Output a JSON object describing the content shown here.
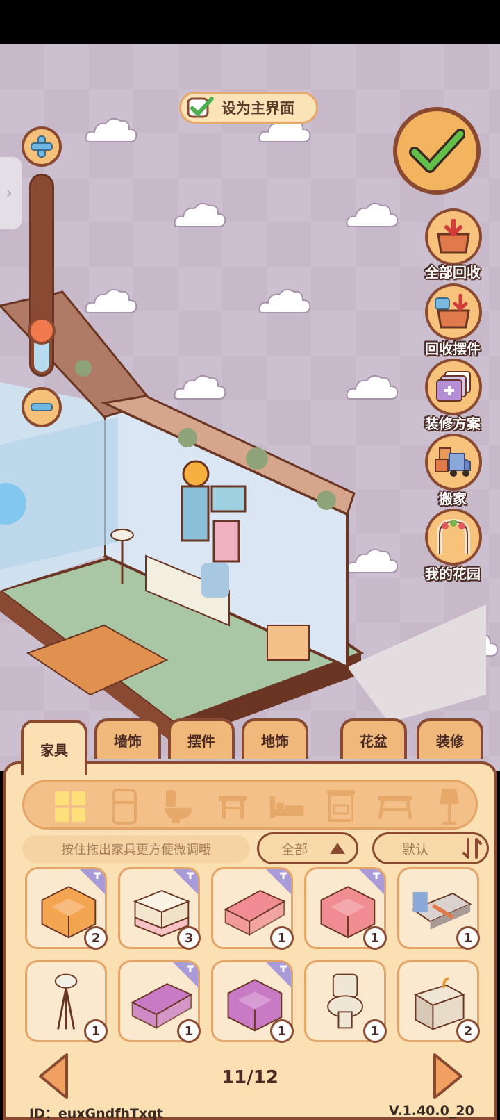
{
  "top_button": {
    "label": "设为主界面"
  },
  "side_buttons": [
    {
      "label": "全部回收",
      "icon": "recycle-box-icon"
    },
    {
      "label": "回收摆件",
      "icon": "recycle-ornament-icon"
    },
    {
      "label": "装修方案",
      "icon": "decoration-plan-icon"
    },
    {
      "label": "搬家",
      "icon": "moving-truck-icon"
    },
    {
      "label": "我的花园",
      "icon": "garden-arch-icon"
    }
  ],
  "zoom": {
    "level_fraction": 0.28
  },
  "tabs": [
    "家具",
    "墙饰",
    "摆件",
    "地饰",
    "花盆",
    "装修"
  ],
  "active_tab": "家具",
  "categories": [
    "grid-icon",
    "fridge-icon",
    "toilet-icon",
    "table-icon",
    "bed-icon",
    "cabinet-icon",
    "desk-icon",
    "lamp-icon"
  ],
  "hint": "按住拖出家具更方便微调哦",
  "filter": {
    "label": "全部"
  },
  "sort": {
    "label": "默认"
  },
  "items": [
    {
      "name": "orange-corner-sofa",
      "count": "2",
      "color": "#f3a552",
      "new": true
    },
    {
      "name": "cream-pink-ottoman",
      "count": "3",
      "color": "#f6c2c4",
      "new": true
    },
    {
      "name": "pink-sofa",
      "count": "1",
      "color": "#ef8d93",
      "new": true
    },
    {
      "name": "pink-corner-sofa",
      "count": "1",
      "color": "#ef8d93",
      "new": true
    },
    {
      "name": "single-bed",
      "count": "1",
      "color": "#d9d2cf",
      "new": false
    },
    {
      "name": "floor-lamp",
      "count": "1",
      "color": "#f3efe6",
      "new": false
    },
    {
      "name": "purple-sofa",
      "count": "1",
      "color": "#c87bc4",
      "new": true
    },
    {
      "name": "purple-corner-sofa",
      "count": "1",
      "color": "#c87bc4",
      "new": true
    },
    {
      "name": "toilet",
      "count": "1",
      "color": "#efe6d6",
      "new": false
    },
    {
      "name": "wash-basin",
      "count": "2",
      "color": "#efe6d6",
      "new": false
    }
  ],
  "pagination": {
    "text": "11/12"
  },
  "footer": {
    "id": "ID：euxGndfhTxqt",
    "version": "V.1.40.0_20"
  }
}
